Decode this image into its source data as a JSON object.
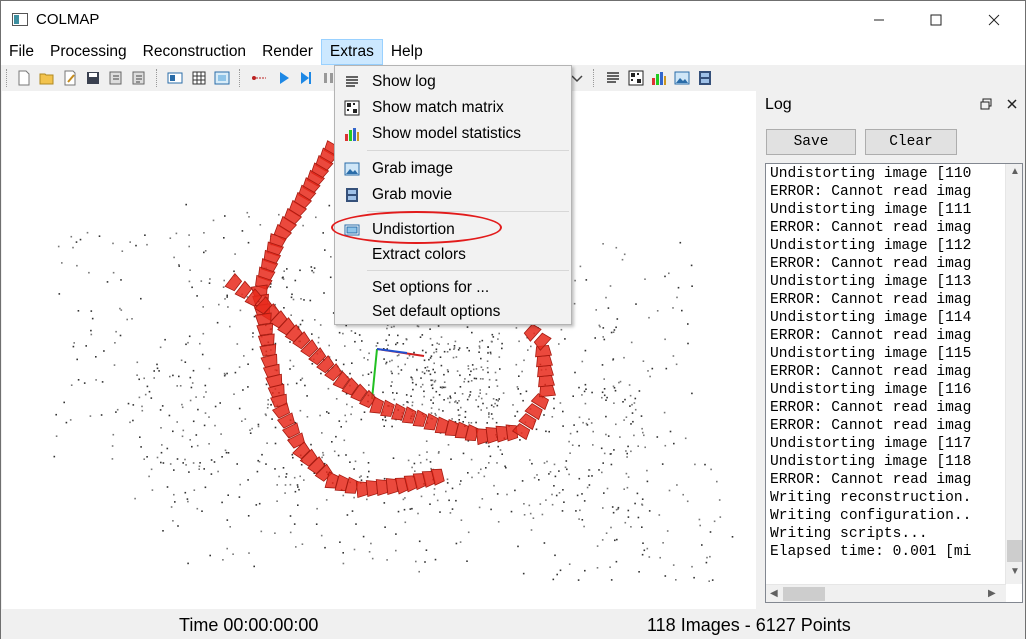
{
  "window": {
    "title": "COLMAP"
  },
  "menubar": [
    {
      "label": "File"
    },
    {
      "label": "Processing"
    },
    {
      "label": "Reconstruction"
    },
    {
      "label": "Render"
    },
    {
      "label": "Extras",
      "active": true
    },
    {
      "label": "Help"
    }
  ],
  "extras_menu": {
    "items": [
      {
        "label": "Show log",
        "icon": "list-icon"
      },
      {
        "label": "Show match matrix",
        "icon": "matrix-icon"
      },
      {
        "label": "Show model statistics",
        "icon": "bar-chart-icon"
      },
      {
        "label": "Grab image",
        "icon": "image-icon"
      },
      {
        "label": "Grab movie",
        "icon": "film-icon"
      },
      {
        "label": "Undistortion",
        "icon": "undistort-icon",
        "highlighted": true
      },
      {
        "label": "Extract colors"
      },
      {
        "label": "Set options for ..."
      },
      {
        "label": "Set default options"
      }
    ]
  },
  "log": {
    "title": "Log",
    "save_label": "Save",
    "clear_label": "Clear",
    "lines": [
      "Undistorting image [110",
      "ERROR: Cannot read imag",
      "Undistorting image [111",
      "ERROR: Cannot read imag",
      "Undistorting image [112",
      "ERROR: Cannot read imag",
      "Undistorting image [113",
      "ERROR: Cannot read imag",
      "Undistorting image [114",
      "ERROR: Cannot read imag",
      "Undistorting image [115",
      "ERROR: Cannot read imag",
      "Undistorting image [116",
      "ERROR: Cannot read imag",
      "ERROR: Cannot read imag",
      "Undistorting image [117",
      "Undistorting image [118",
      "ERROR: Cannot read imag",
      "Writing reconstruction.",
      "Writing configuration..",
      "Writing scripts...",
      "Elapsed time: 0.001 [mi"
    ]
  },
  "status": {
    "time": "Time 00:00:00:00",
    "counts": "118 Images - 6127 Points"
  },
  "colors": {
    "camera": "#e8291b",
    "highlight_ellipse": "#e21b1b",
    "menu_active": "#cce8ff"
  }
}
